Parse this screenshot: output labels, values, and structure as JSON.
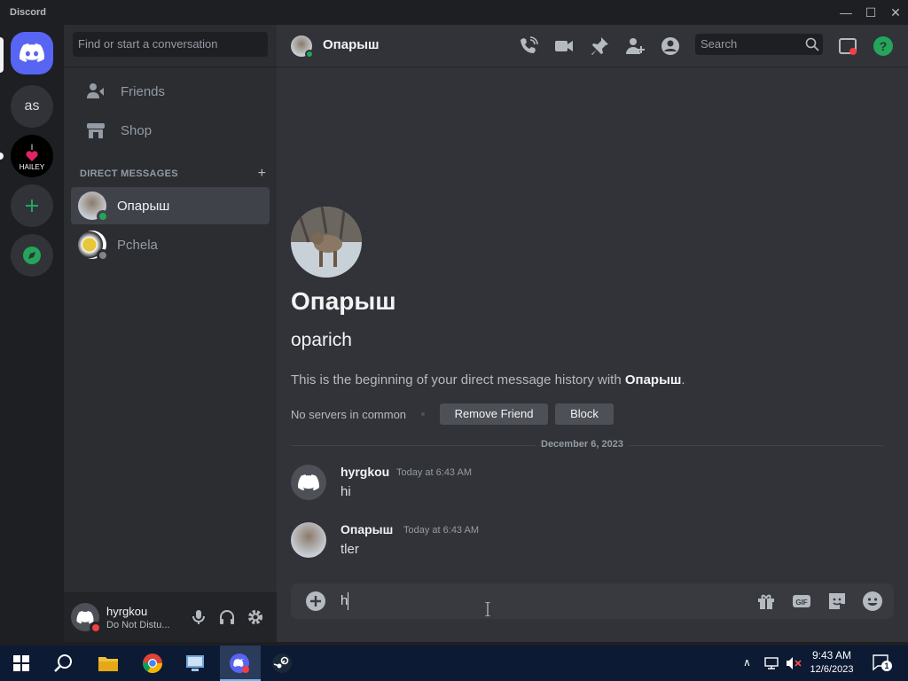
{
  "app": {
    "name": "Discord"
  },
  "window": {
    "minimize": "—",
    "maximize": "☐",
    "close": "✕"
  },
  "guilds": [
    {
      "label": "as"
    },
    {
      "label": "I ❤ HAILEY"
    }
  ],
  "sidebar": {
    "search_placeholder": "Find or start a conversation",
    "nav": [
      {
        "label": "Friends",
        "icon": "friends-icon"
      },
      {
        "label": "Shop",
        "icon": "shop-icon"
      }
    ],
    "dm_header": "DIRECT MESSAGES",
    "dms": [
      {
        "name": "Опарыш",
        "status": "online",
        "active": true
      },
      {
        "name": "Pchela",
        "status": "offline",
        "active": false
      }
    ]
  },
  "user": {
    "name": "hyrgkou",
    "status": "Do Not Distu..."
  },
  "header": {
    "title": "Опарыш",
    "search_placeholder": "Search"
  },
  "intro": {
    "name": "Опарыш",
    "username": "oparich",
    "text_prefix": "This is the beginning of your direct message history with ",
    "text_name": "Опарыш",
    "text_suffix": ".",
    "mutual": "No servers in common",
    "remove_friend": "Remove Friend",
    "block": "Block"
  },
  "date_divider": "December 6, 2023",
  "messages": [
    {
      "author": "hyrgkou",
      "time": "Today at 6:43 AM",
      "text": "hi"
    },
    {
      "author": "Опарыш",
      "time": "Today at 6:43 AM",
      "text": "tler"
    }
  ],
  "composer": {
    "draft": "h"
  },
  "taskbar": {
    "time": "9:43 AM",
    "date": "12/6/2023",
    "notifications": "1"
  },
  "colors": {
    "blurple": "#5865f2",
    "online": "#23a55a",
    "dnd": "#f23f43",
    "green": "#23a55a"
  }
}
